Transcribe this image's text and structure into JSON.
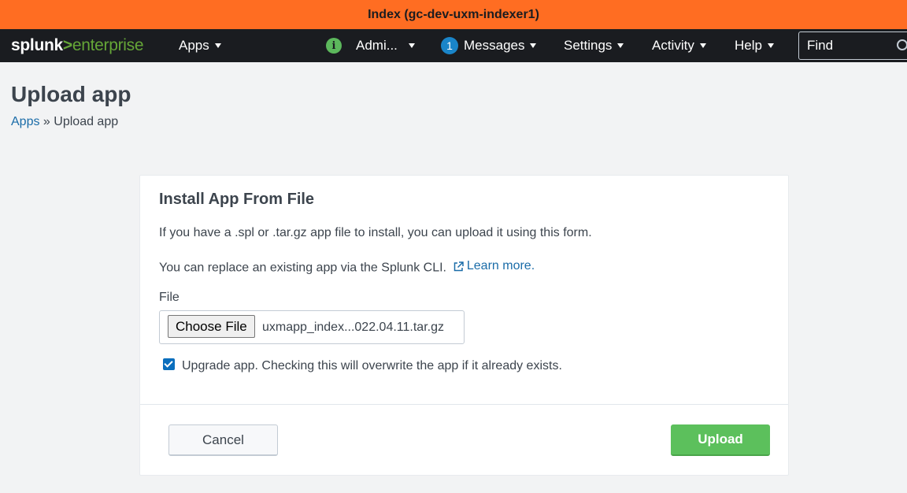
{
  "banner": {
    "title": "Index (gc-dev-uxm-indexer1)",
    "color": "#ff6d22"
  },
  "navbar": {
    "logo": {
      "part1": "splunk",
      "part2": ">",
      "part3": "enterprise"
    },
    "apps_label": "Apps",
    "admin_label": "Admi...",
    "messages_count": "1",
    "messages_label": "Messages",
    "settings_label": "Settings",
    "activity_label": "Activity",
    "help_label": "Help",
    "find_placeholder": "Find"
  },
  "page": {
    "title": "Upload app",
    "breadcrumb": {
      "parent": "Apps",
      "separator": "»",
      "current": "Upload app"
    }
  },
  "form": {
    "title": "Install App From File",
    "intro": "If you have a .spl or .tar.gz app file to install, you can upload it using this form.",
    "cli_text": "You can replace an existing app via the Splunk CLI.",
    "learn_more": "Learn more.",
    "file_label": "File",
    "choose_file": "Choose File",
    "file_name": "uxmapp_index...022.04.11.tar.gz",
    "upgrade_label": "Upgrade app. Checking this will overwrite the app if it already exists.",
    "upgrade_checked": true,
    "cancel_label": "Cancel",
    "upload_label": "Upload"
  },
  "icons": {
    "info": "info-icon",
    "search": "search-icon",
    "external_link": "external-link-icon"
  },
  "info_glyph": "i"
}
